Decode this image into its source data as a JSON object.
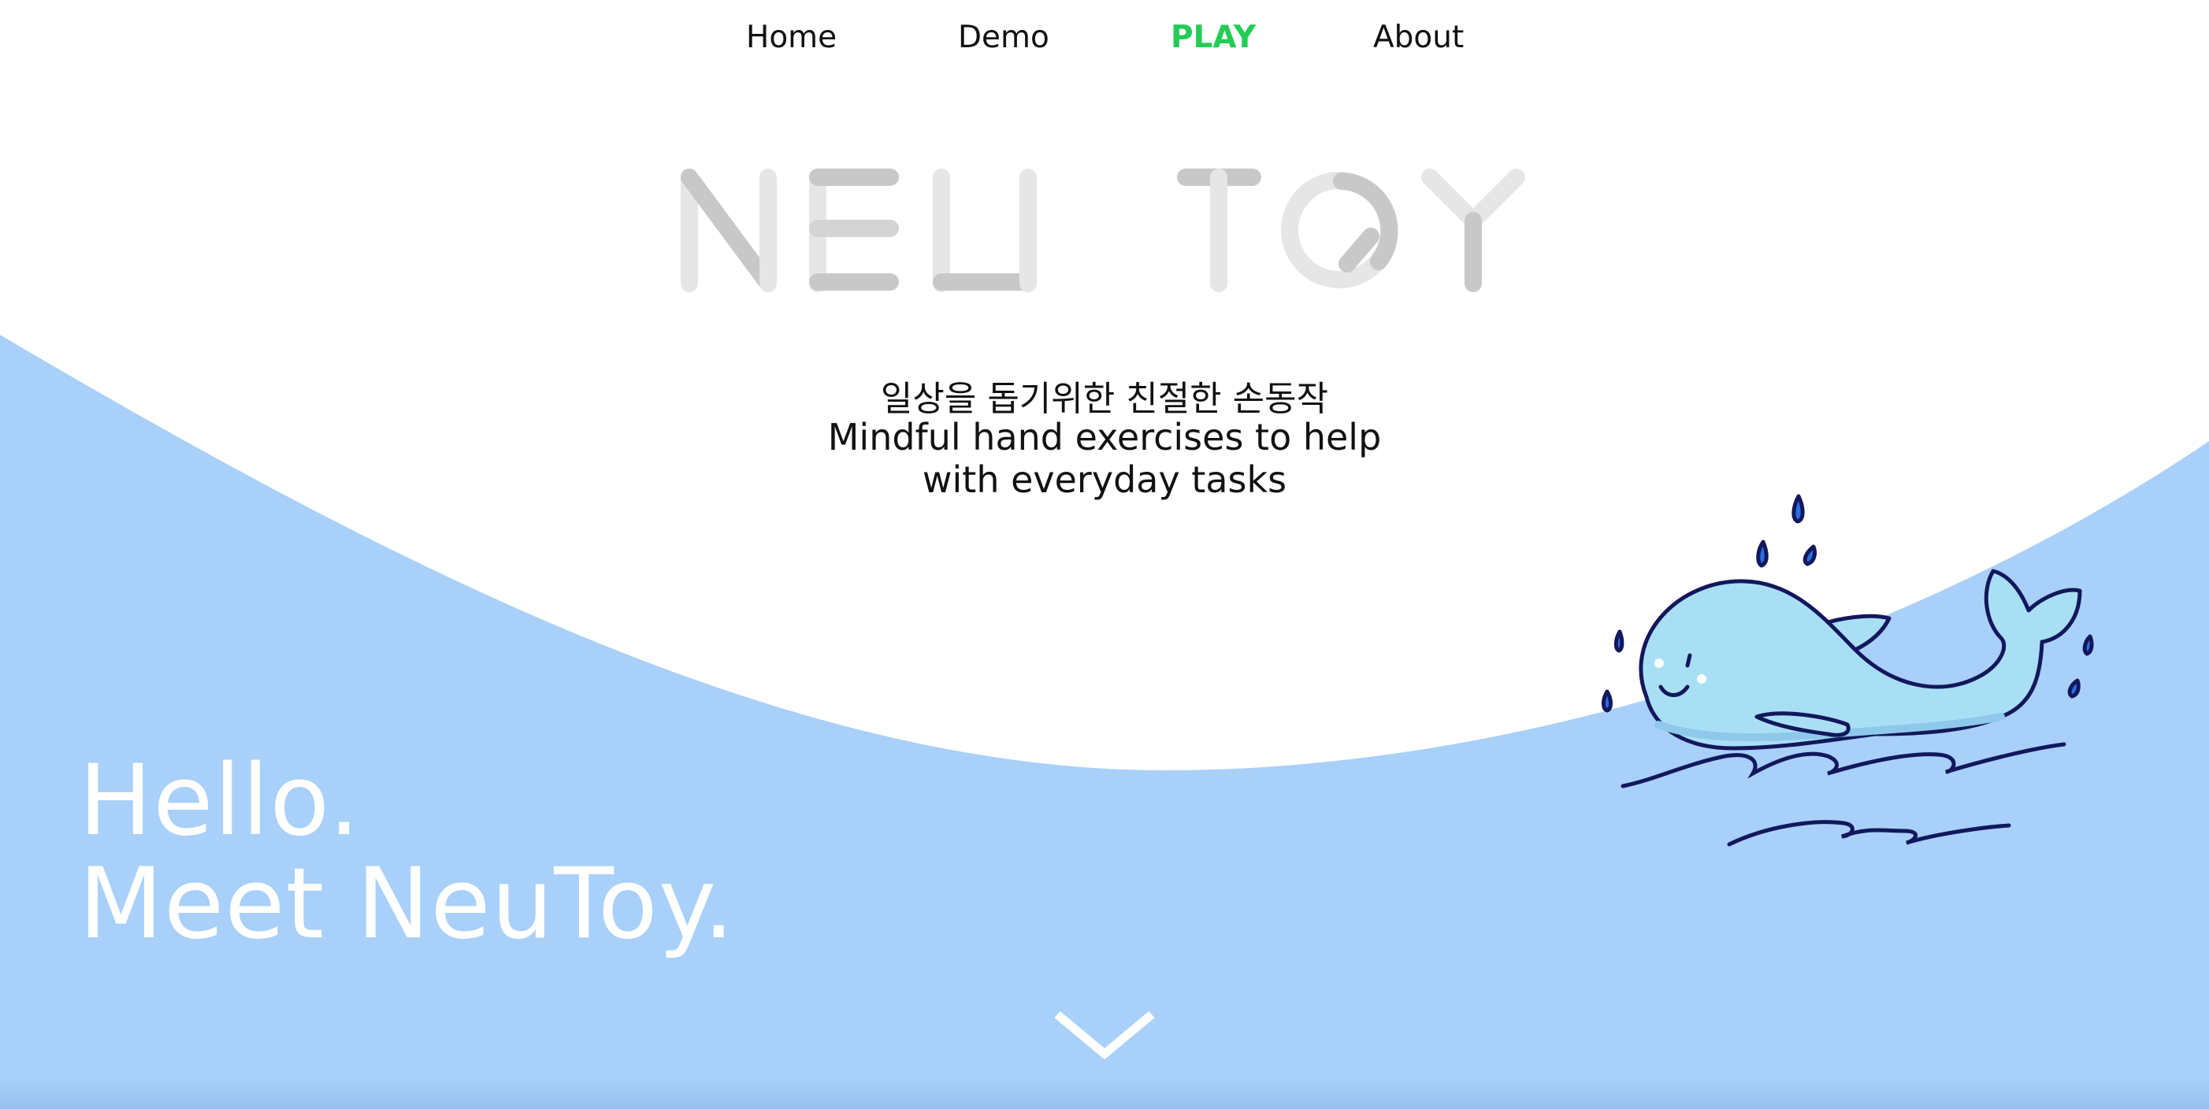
{
  "nav": {
    "items": [
      {
        "label": "Home"
      },
      {
        "label": "Demo"
      },
      {
        "label": "PLAY"
      },
      {
        "label": "About"
      }
    ],
    "active_color": "#22cc55"
  },
  "logo": {
    "text": "NEU TOY"
  },
  "tagline": {
    "korean": "일상을 돕기위한 친절한 손동작",
    "english_line1": "Mindful hand exercises to help",
    "english_line2": "with everyday tasks"
  },
  "hero": {
    "line1": "Hello.",
    "line2": "Meet NeuToy."
  },
  "colors": {
    "wave_blue": "#a8d0f9",
    "whale_body": "#a9dff5",
    "outline_navy": "#13175c",
    "logo_light": "#e6e6e6",
    "logo_dark": "#c8c8c8"
  },
  "icons": {
    "scroll": "chevron-down-icon",
    "mascot": "whale-illustration"
  }
}
